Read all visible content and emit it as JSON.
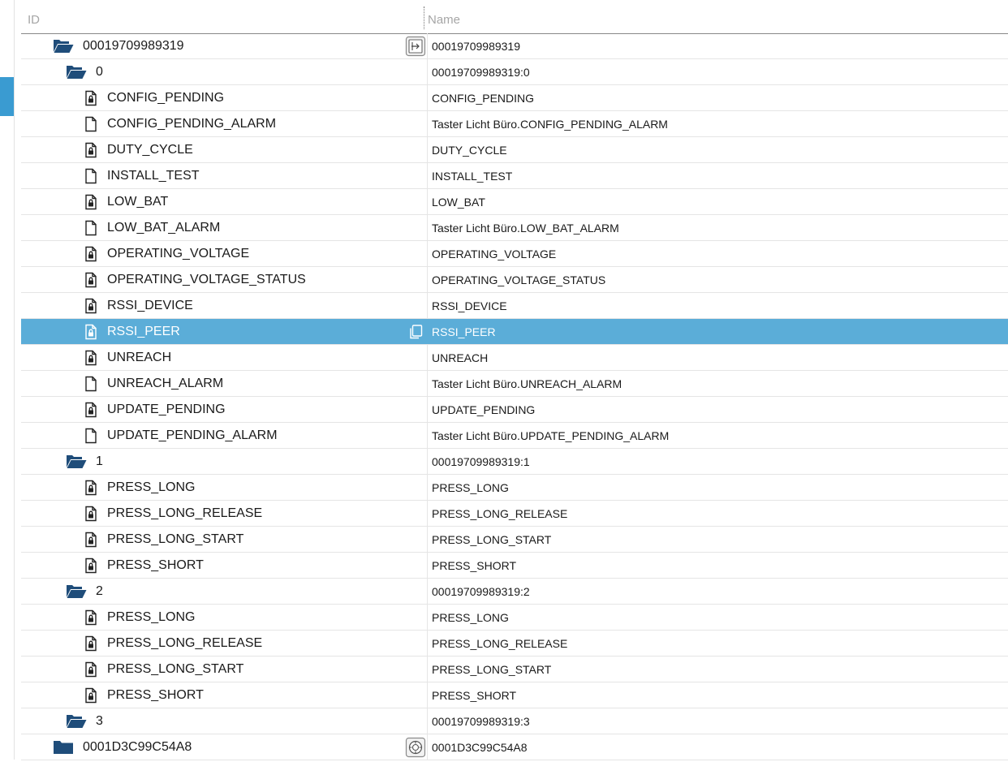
{
  "header": {
    "id_label": "ID",
    "name_label": "Name"
  },
  "colors": {
    "selected_row": "#5badd8",
    "folder": "#1f4d7a",
    "side_accent": "#3a9bd1"
  },
  "rows": [
    {
      "level": 0,
      "kind": "folder-open",
      "id": "00019709989319",
      "name": "00019709989319",
      "action": "device-info"
    },
    {
      "level": 1,
      "kind": "folder-open",
      "id": "0",
      "name": "00019709989319:0"
    },
    {
      "level": 2,
      "kind": "file-locked",
      "id": "CONFIG_PENDING",
      "name": "CONFIG_PENDING"
    },
    {
      "level": 2,
      "kind": "file",
      "id": "CONFIG_PENDING_ALARM",
      "name": "Taster Licht Büro.CONFIG_PENDING_ALARM"
    },
    {
      "level": 2,
      "kind": "file-locked",
      "id": "DUTY_CYCLE",
      "name": "DUTY_CYCLE"
    },
    {
      "level": 2,
      "kind": "file",
      "id": "INSTALL_TEST",
      "name": "INSTALL_TEST"
    },
    {
      "level": 2,
      "kind": "file-locked",
      "id": "LOW_BAT",
      "name": "LOW_BAT"
    },
    {
      "level": 2,
      "kind": "file",
      "id": "LOW_BAT_ALARM",
      "name": "Taster Licht Büro.LOW_BAT_ALARM"
    },
    {
      "level": 2,
      "kind": "file-locked",
      "id": "OPERATING_VOLTAGE",
      "name": "OPERATING_VOLTAGE"
    },
    {
      "level": 2,
      "kind": "file-locked",
      "id": "OPERATING_VOLTAGE_STATUS",
      "name": "OPERATING_VOLTAGE_STATUS"
    },
    {
      "level": 2,
      "kind": "file-locked",
      "id": "RSSI_DEVICE",
      "name": "RSSI_DEVICE"
    },
    {
      "level": 2,
      "kind": "file-locked",
      "id": "RSSI_PEER",
      "name": "RSSI_PEER",
      "selected": true,
      "action": "copy"
    },
    {
      "level": 2,
      "kind": "file-locked",
      "id": "UNREACH",
      "name": "UNREACH"
    },
    {
      "level": 2,
      "kind": "file",
      "id": "UNREACH_ALARM",
      "name": "Taster Licht Büro.UNREACH_ALARM"
    },
    {
      "level": 2,
      "kind": "file-locked",
      "id": "UPDATE_PENDING",
      "name": "UPDATE_PENDING"
    },
    {
      "level": 2,
      "kind": "file",
      "id": "UPDATE_PENDING_ALARM",
      "name": "Taster Licht Büro.UPDATE_PENDING_ALARM"
    },
    {
      "level": 1,
      "kind": "folder-open",
      "id": "1",
      "name": "00019709989319:1"
    },
    {
      "level": 2,
      "kind": "file-locked",
      "id": "PRESS_LONG",
      "name": "PRESS_LONG"
    },
    {
      "level": 2,
      "kind": "file-locked",
      "id": "PRESS_LONG_RELEASE",
      "name": "PRESS_LONG_RELEASE"
    },
    {
      "level": 2,
      "kind": "file-locked",
      "id": "PRESS_LONG_START",
      "name": "PRESS_LONG_START"
    },
    {
      "level": 2,
      "kind": "file-locked",
      "id": "PRESS_SHORT",
      "name": "PRESS_SHORT"
    },
    {
      "level": 1,
      "kind": "folder-open",
      "id": "2",
      "name": "00019709989319:2"
    },
    {
      "level": 2,
      "kind": "file-locked",
      "id": "PRESS_LONG",
      "name": "PRESS_LONG"
    },
    {
      "level": 2,
      "kind": "file-locked",
      "id": "PRESS_LONG_RELEASE",
      "name": "PRESS_LONG_RELEASE"
    },
    {
      "level": 2,
      "kind": "file-locked",
      "id": "PRESS_LONG_START",
      "name": "PRESS_LONG_START"
    },
    {
      "level": 2,
      "kind": "file-locked",
      "id": "PRESS_SHORT",
      "name": "PRESS_SHORT"
    },
    {
      "level": 1,
      "kind": "folder-open",
      "id": "3",
      "name": "00019709989319:3"
    },
    {
      "level": 0,
      "kind": "folder-closed",
      "id": "0001D3C99C54A8",
      "name": "0001D3C99C54A8",
      "action": "device-rotate"
    }
  ]
}
